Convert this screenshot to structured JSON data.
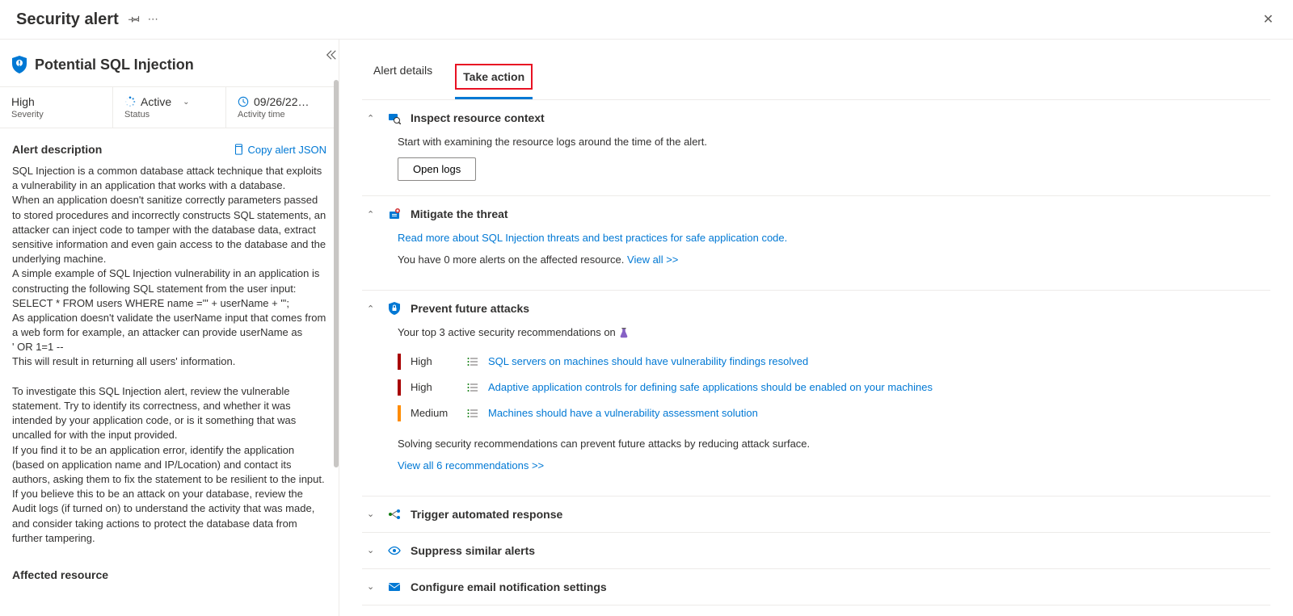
{
  "header": {
    "title": "Security alert"
  },
  "left": {
    "alert_title": "Potential SQL Injection",
    "severity": {
      "value": "High",
      "label": "Severity"
    },
    "status": {
      "value": "Active",
      "label": "Status"
    },
    "activity": {
      "value": "09/26/22…",
      "label": "Activity time"
    },
    "desc_header": "Alert description",
    "copy_json": "Copy alert JSON",
    "description_html": "SQL Injection is a common database attack technique that exploits a vulnerability in an application that works with a database.<br>When an application doesn't sanitize correctly parameters passed to stored procedures and incorrectly constructs SQL statements, an attacker can inject code to tamper with the database data, extract sensitive information and even gain access to the database and the underlying machine.<br>A simple example of SQL Injection vulnerability in an application is constructing the following SQL statement from the user input:<br>SELECT * FROM users WHERE name ='\" + userName + \"';<br>As application doesn't validate the userName input that comes from a web form for example, an attacker can provide userName as<br>' OR 1=1 --<br>This will result in returning all users' information.<br><br>To investigate this SQL Injection alert, review the vulnerable statement. Try to identify its correctness, and whether it was intended by your application code, or is it something that was uncalled for with the input provided.<br>If you find it to be an application error, identify the application (based on application name and IP/Location) and contact its authors, asking them to fix the statement to be resilient to the input.<br>If you believe this to be an attack on your database, review the Audit logs (if turned on) to understand the activity that was made, and consider taking actions to protect the database data from further tampering.",
    "affected_header": "Affected resource"
  },
  "tabs": {
    "details": "Alert details",
    "take_action": "Take action"
  },
  "actions": {
    "inspect": {
      "title": "Inspect resource context",
      "body": "Start with examining the resource logs around the time of the alert.",
      "button": "Open logs"
    },
    "mitigate": {
      "title": "Mitigate the threat",
      "link": "Read more about SQL Injection threats and best practices for safe application code.",
      "more_alerts": "You have 0 more alerts on the affected resource. ",
      "view_all": "View all >>"
    },
    "prevent": {
      "title": "Prevent future attacks",
      "intro": "Your top 3 active security recommendations on ",
      "recs": [
        {
          "sev": "High",
          "sev_class": "high",
          "text": "SQL servers on machines should have vulnerability findings resolved"
        },
        {
          "sev": "High",
          "sev_class": "high",
          "text": "Adaptive application controls for defining safe applications should be enabled on your machines"
        },
        {
          "sev": "Medium",
          "sev_class": "medium",
          "text": "Machines should have a vulnerability assessment solution"
        }
      ],
      "footer": "Solving security recommendations can prevent future attacks by reducing attack surface.",
      "view_all": "View all 6 recommendations >>"
    },
    "trigger": {
      "title": "Trigger automated response"
    },
    "suppress": {
      "title": "Suppress similar alerts"
    },
    "email": {
      "title": "Configure email notification settings"
    }
  }
}
